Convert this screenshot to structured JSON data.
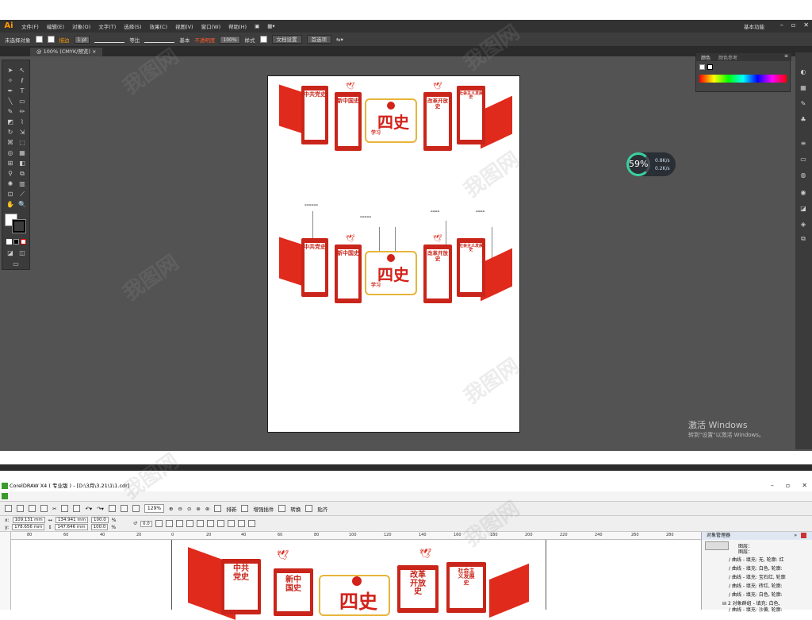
{
  "ai": {
    "logo": "Ai",
    "menu": [
      "文件(F)",
      "编辑(E)",
      "对象(O)",
      "文字(T)",
      "选择(S)",
      "效果(C)",
      "视图(V)",
      "窗口(W)",
      "帮助(H)"
    ],
    "workspace": "基本功能",
    "window_controls": [
      "–",
      "▫",
      "✕"
    ],
    "control_bar": {
      "selection": "未选择对象",
      "stroke_label": "描边",
      "stroke_weight": "1 pt",
      "profile": "等比",
      "brush": "基本",
      "opacity_label": "不透明度",
      "opacity_value": "100%",
      "style_label": "样式",
      "doc_setup": "文档设置",
      "preferences": "首选项"
    },
    "doc_tab": "@ 100% (CMYK/预览)",
    "color_panel": {
      "tab1": "颜色",
      "tab2": "颜色参考"
    },
    "speed_widget": {
      "percent": "59%",
      "up": "0.8K/s",
      "down": "0.2K/s"
    },
    "activate": {
      "line1": "激活 Windows",
      "line2": "转到\"设置\"以激活 Windows。"
    }
  },
  "artwork": {
    "panels": [
      "中共党史",
      "新中国史",
      "改革开放史",
      "社会主义发展史"
    ],
    "center_title": "四史",
    "center_sub": "学习"
  },
  "cd": {
    "title": "CorelDRAW X4 ( 专业版 ) - [D:\\3月\\3.21\\1\\1.cdr]",
    "window_controls": [
      "–",
      "▫",
      "✕"
    ],
    "toolbar": {
      "zoom": "129%",
      "labels": [
        "排新",
        "增强插件",
        "转换",
        "贴齐"
      ]
    },
    "props": {
      "x": "109.131 mm",
      "y": "178.656 mm",
      "w": "134.941 mm",
      "h": "147.646 mm",
      "sx": "100.0",
      "sy": "100.0",
      "percent": "%",
      "angle": "0.0"
    },
    "ruler_ticks": [
      "80",
      "60",
      "40",
      "20",
      "0",
      "20",
      "40",
      "60",
      "80",
      "100",
      "120",
      "140",
      "160",
      "180",
      "200",
      "220",
      "240",
      "260",
      "280"
    ],
    "objmgr": {
      "title": "对象管理器",
      "layer_label": "图层：",
      "rows": [
        "曲线 - 填充: 无, 轮廓: 红",
        "曲线 - 填充: 白色, 轮廓:",
        "曲线 - 填充: 宝石红, 轮廓",
        "曲线 - 填充: 砖红, 轮廓:",
        "曲线 - 填充: 白色, 轮廓:",
        "2 对象群组 - 填充: 白色,",
        "曲线 - 填充: 沙黄, 轮廓:"
      ]
    }
  },
  "watermark": "我图网"
}
